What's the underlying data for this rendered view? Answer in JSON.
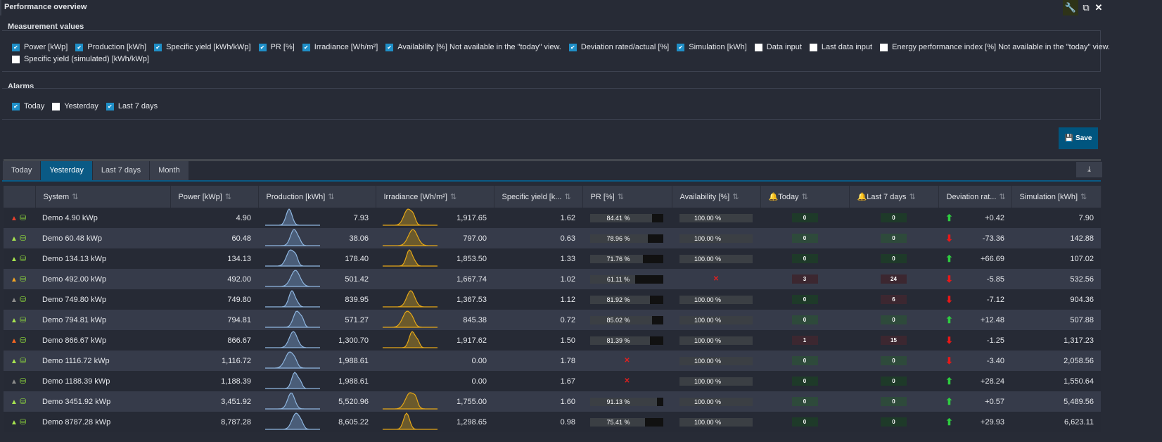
{
  "window": {
    "title": "Performance overview",
    "icons": [
      "wrench-icon",
      "restore-window-icon",
      "close-icon"
    ]
  },
  "measurement": {
    "title": "Measurement values",
    "options": [
      {
        "label": "Power [kWp]",
        "checked": true
      },
      {
        "label": "Production [kWh]",
        "checked": true
      },
      {
        "label": "Specific yield [kWh/kWp]",
        "checked": true
      },
      {
        "label": "PR [%]",
        "checked": true
      },
      {
        "label": "Irradiance [Wh/m²]",
        "checked": true
      },
      {
        "label": "Availability [%] Not available in the \"today\" view.",
        "checked": true
      },
      {
        "label": "Deviation rated/actual [%]",
        "checked": true
      },
      {
        "label": "Simulation [kWh]",
        "checked": true
      },
      {
        "label": "Data input",
        "checked": false
      },
      {
        "label": "Last data input",
        "checked": false
      },
      {
        "label": "Energy performance index [%] Not available in the \"today\" view.",
        "checked": false
      },
      {
        "label": "Specific yield (simulated) [kWh/kWp]",
        "checked": false
      }
    ]
  },
  "alarms": {
    "title": "Alarms",
    "options": [
      {
        "label": "Today",
        "checked": true
      },
      {
        "label": "Yesterday",
        "checked": false
      },
      {
        "label": "Last 7 days",
        "checked": true
      }
    ]
  },
  "save_label": "Save",
  "tabs": [
    {
      "label": "Today",
      "active": false
    },
    {
      "label": "Yesterday",
      "active": true
    },
    {
      "label": "Last 7 days",
      "active": false
    },
    {
      "label": "Month",
      "active": false
    }
  ],
  "columns": [
    "",
    "System",
    "Power [kWp]",
    "Production [kWh]",
    "Irradiance [Wh/m²]",
    "Specific yield [k...",
    "PR [%]",
    "Availability [%]",
    "Today",
    "Last 7 days",
    "Deviation rat...",
    "Simulation [kWh]"
  ],
  "colors": {
    "accent": "#0a5a85",
    "bell_red": "#e8412c",
    "bell_green": "#a6e34f",
    "bell_orange": "#f5a623",
    "bell_gray": "#8c8c8c",
    "bell_orange_red": "#f26522",
    "up": "#2ecc40",
    "down": "#e81818"
  },
  "rows": [
    {
      "bell": "red",
      "system": "Demo 4.90 kWp",
      "power": "4.90",
      "production": "7.93",
      "irradiance": "1,917.65",
      "irr_chart": true,
      "specific_yield": "1.62",
      "pr": 84.41,
      "pr_label": "84.41 %",
      "availability": 100,
      "availability_label": "100.00 %",
      "today": "0",
      "last7": "0",
      "trend": "up",
      "deviation": "+0.42",
      "simulation": "7.90"
    },
    {
      "bell": "green",
      "system": "Demo 60.48 kWp",
      "power": "60.48",
      "production": "38.06",
      "irradiance": "797.00",
      "irr_chart": true,
      "specific_yield": "0.63",
      "pr": 78.96,
      "pr_label": "78.96 %",
      "availability": 100,
      "availability_label": "100.00 %",
      "today": "0",
      "last7": "0",
      "trend": "down",
      "deviation": "-73.36",
      "simulation": "142.88"
    },
    {
      "bell": "green",
      "system": "Demo 134.13 kWp",
      "power": "134.13",
      "production": "178.40",
      "irradiance": "1,853.50",
      "irr_chart": true,
      "specific_yield": "1.33",
      "pr": 71.76,
      "pr_label": "71.76 %",
      "availability": 100,
      "availability_label": "100.00 %",
      "today": "0",
      "last7": "0",
      "trend": "up",
      "deviation": "+66.69",
      "simulation": "107.02"
    },
    {
      "bell": "orange",
      "system": "Demo 492.00 kWp",
      "power": "492.00",
      "production": "501.42",
      "irradiance": "1,667.74",
      "irr_chart": false,
      "specific_yield": "1.02",
      "pr": 61.11,
      "pr_label": "61.11 %",
      "availability": null,
      "availability_label": null,
      "today": "3",
      "last7": "24",
      "trend": "down",
      "deviation": "-5.85",
      "simulation": "532.56"
    },
    {
      "bell": "gray",
      "system": "Demo 749.80 kWp",
      "power": "749.80",
      "production": "839.95",
      "irradiance": "1,367.53",
      "irr_chart": true,
      "specific_yield": "1.12",
      "pr": 81.92,
      "pr_label": "81.92 %",
      "availability": 100,
      "availability_label": "100.00 %",
      "today": "0",
      "last7": "6",
      "trend": "down",
      "deviation": "-7.12",
      "simulation": "904.36"
    },
    {
      "bell": "green",
      "system": "Demo 794.81 kWp",
      "power": "794.81",
      "production": "571.27",
      "irradiance": "845.38",
      "irr_chart": true,
      "specific_yield": "0.72",
      "pr": 85.02,
      "pr_label": "85.02 %",
      "availability": 100,
      "availability_label": "100.00 %",
      "today": "0",
      "last7": "0",
      "trend": "up",
      "deviation": "+12.48",
      "simulation": "507.88"
    },
    {
      "bell": "orange_red",
      "system": "Demo 866.67 kWp",
      "power": "866.67",
      "production": "1,300.70",
      "irradiance": "1,917.62",
      "irr_chart": true,
      "specific_yield": "1.50",
      "pr": 81.39,
      "pr_label": "81.39 %",
      "availability": 100,
      "availability_label": "100.00 %",
      "today": "1",
      "last7": "15",
      "trend": "down",
      "deviation": "-1.25",
      "simulation": "1,317.23"
    },
    {
      "bell": "green",
      "system": "Demo 1116.72 kWp",
      "power": "1,116.72",
      "production": "1,988.61",
      "irradiance": "0.00",
      "irr_chart": false,
      "specific_yield": "1.78",
      "pr": null,
      "pr_label": null,
      "availability": 100,
      "availability_label": "100.00 %",
      "today": "0",
      "last7": "0",
      "trend": "down",
      "deviation": "-3.40",
      "simulation": "2,058.56"
    },
    {
      "bell": "gray",
      "system": "Demo 1188.39 kWp",
      "power": "1,188.39",
      "production": "1,988.61",
      "irradiance": "0.00",
      "irr_chart": false,
      "specific_yield": "1.67",
      "pr": null,
      "pr_label": null,
      "availability": 100,
      "availability_label": "100.00 %",
      "today": "0",
      "last7": "0",
      "trend": "up",
      "deviation": "+28.24",
      "simulation": "1,550.64"
    },
    {
      "bell": "green",
      "system": "Demo 3451.92 kWp",
      "power": "3,451.92",
      "production": "5,520.96",
      "irradiance": "1,755.00",
      "irr_chart": true,
      "specific_yield": "1.60",
      "pr": 91.13,
      "pr_label": "91.13 %",
      "availability": 100,
      "availability_label": "100.00 %",
      "today": "0",
      "last7": "0",
      "trend": "up",
      "deviation": "+0.57",
      "simulation": "5,489.56"
    },
    {
      "bell": "green",
      "system": "Demo 8787.28 kWp",
      "power": "8,787.28",
      "production": "8,605.22",
      "irradiance": "1,298.65",
      "irr_chart": true,
      "specific_yield": "0.98",
      "pr": 75.41,
      "pr_label": "75.41 %",
      "availability": 100,
      "availability_label": "100.00 %",
      "today": "0",
      "last7": "0",
      "trend": "up",
      "deviation": "+29.93",
      "simulation": "6,623.11"
    }
  ]
}
